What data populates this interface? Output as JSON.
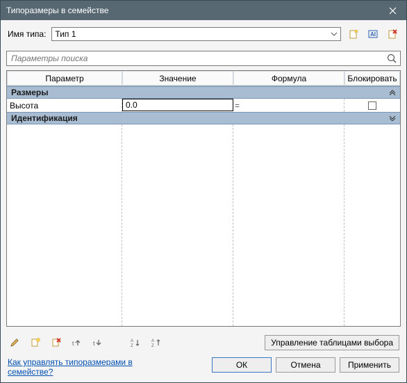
{
  "window": {
    "title": "Типоразмеры в семействе"
  },
  "type": {
    "label": "Имя типа:",
    "selected": "Тип 1"
  },
  "search": {
    "placeholder": "Параметры поиска"
  },
  "table": {
    "headers": {
      "param": "Параметр",
      "value": "Значение",
      "formula": "Формула",
      "lock": "Блокировать"
    },
    "groups": {
      "sizes": "Размеры",
      "identify": "Идентификация"
    },
    "rows": [
      {
        "param": "Высота",
        "value": "0.0",
        "formula": "",
        "locked": false
      }
    ]
  },
  "icons": {
    "new_type": "new-type-icon",
    "rename_type": "rename-type-icon",
    "delete_type": "delete-type-icon",
    "edit": "pencil-icon",
    "add_param": "add-param-icon",
    "delete_param": "delete-param-icon",
    "move_up": "move-up-icon",
    "move_down": "move-down-icon",
    "sort_asc": "sort-asc-icon",
    "sort_desc": "sort-desc-icon"
  },
  "buttons": {
    "manage_tables": "Управление таблицами выбора",
    "ok": "ОК",
    "cancel": "Отмена",
    "apply": "Применить"
  },
  "help": {
    "text": "Как управлять типоразмерами в семействе?"
  }
}
